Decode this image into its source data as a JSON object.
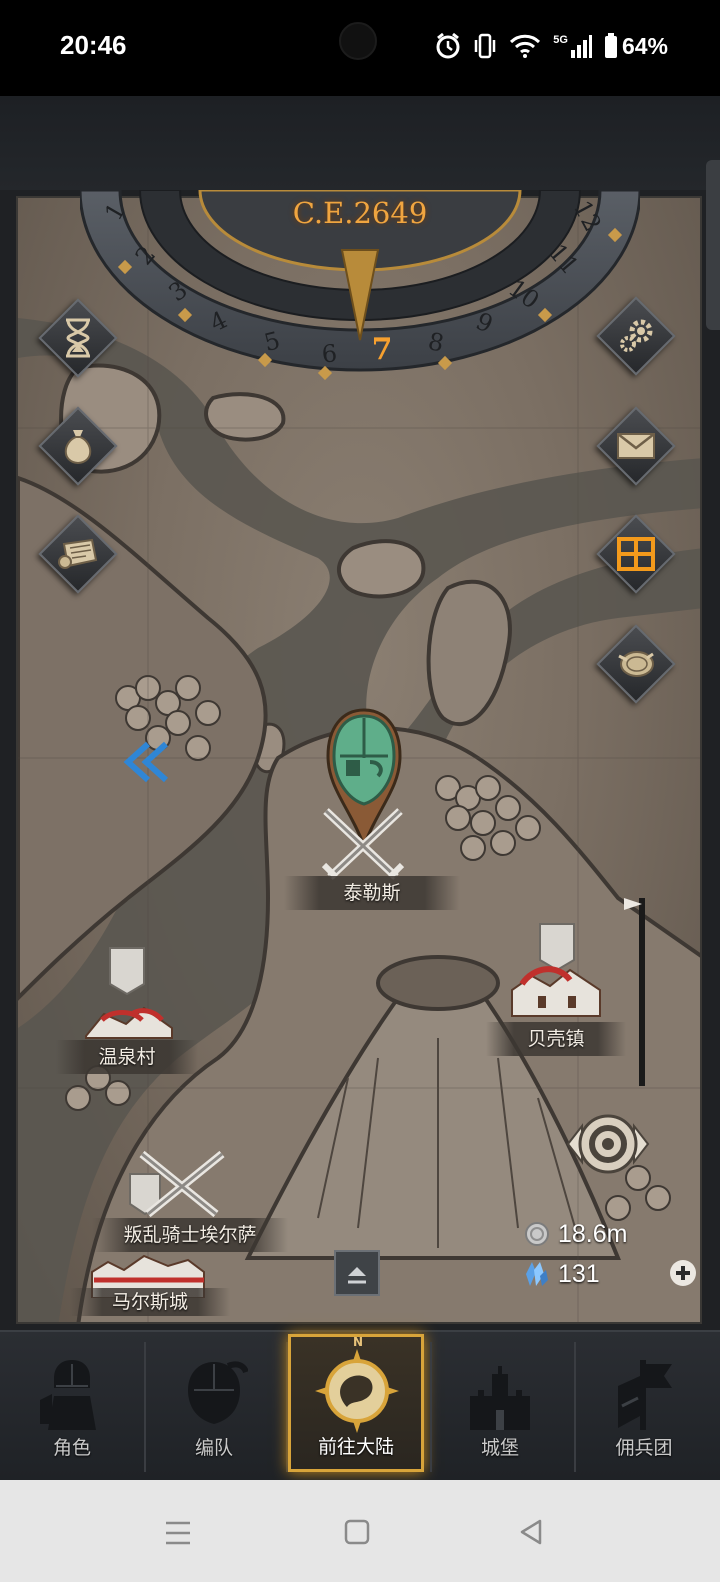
{
  "status_bar": {
    "time": "20:46",
    "network": "5G",
    "battery": "64%",
    "icons": [
      "alarm-icon",
      "vibrate-icon",
      "wifi-icon",
      "signal-icon",
      "battery-icon"
    ]
  },
  "calendar": {
    "year": "C.E.2649",
    "months": [
      "1",
      "2",
      "3",
      "4",
      "5",
      "6",
      "7",
      "8",
      "9",
      "10",
      "11",
      "12"
    ],
    "current_month": "7",
    "accent": "#f6a02f"
  },
  "left_menu": [
    {
      "icon": "hourglass-icon"
    },
    {
      "icon": "money-bag-icon"
    },
    {
      "icon": "scroll-icon"
    }
  ],
  "right_menu": [
    {
      "icon": "gear-icon"
    },
    {
      "icon": "mail-icon"
    },
    {
      "icon": "calendar-grid-icon",
      "highlighted": true
    },
    {
      "icon": "coin-icon"
    }
  ],
  "locations": {
    "taylers": "泰勒斯",
    "hot_spring_village": "温泉村",
    "shell_town": "贝壳镇",
    "rebel_knight": "叛乱骑士埃尔萨",
    "mars_city": "马尔斯城"
  },
  "resources": {
    "silver": "18.6m",
    "crystal": "131"
  },
  "nav": {
    "items": [
      {
        "label": "角色",
        "icon": "knight-icon",
        "active": false
      },
      {
        "label": "编队",
        "icon": "helmet-icon",
        "active": false
      },
      {
        "label": "前往大陆",
        "icon": "compass-icon",
        "active": true
      },
      {
        "label": "城堡",
        "icon": "castle-icon",
        "active": false
      },
      {
        "label": "佣兵团",
        "icon": "banner-icon",
        "active": false
      }
    ],
    "compass_letter": "N"
  },
  "colors": {
    "gold": "#d8a43a",
    "parchment": "#7b6f63",
    "river": "#5a5650",
    "helmet_green": "#5fae8a"
  }
}
